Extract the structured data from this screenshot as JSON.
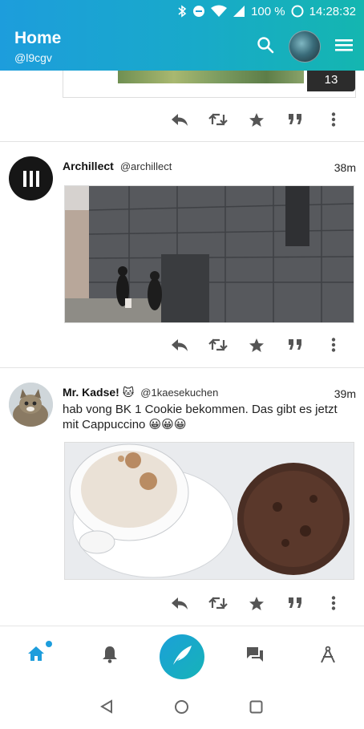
{
  "status_bar": {
    "battery": "100 %",
    "time": "14:28:32"
  },
  "app_bar": {
    "title": "Home",
    "account": "@l9cgv"
  },
  "media_badge": "13",
  "tweets": [
    {
      "name": "Archillect",
      "handle": "@archillect",
      "time": "38m",
      "text": ""
    },
    {
      "name": "Mr. Kadse! 🐱",
      "handle": "@1kaesekuchen",
      "time": "39m",
      "text": "hab vong BK 1 Cookie bekommen. Das gibt es jetzt mit Cappuccino 😀😀😀"
    }
  ],
  "action_icons": [
    "reply-icon",
    "retweet-icon",
    "favorite-icon",
    "quote-icon",
    "more-icon"
  ],
  "bottom_nav": [
    "home-icon",
    "notifications-icon",
    "compose-icon",
    "messages-icon",
    "explore-icon"
  ],
  "colors": {
    "accent": "#1d9ddc",
    "accent_end": "#14b6b0",
    "icon_gray": "#555555"
  }
}
